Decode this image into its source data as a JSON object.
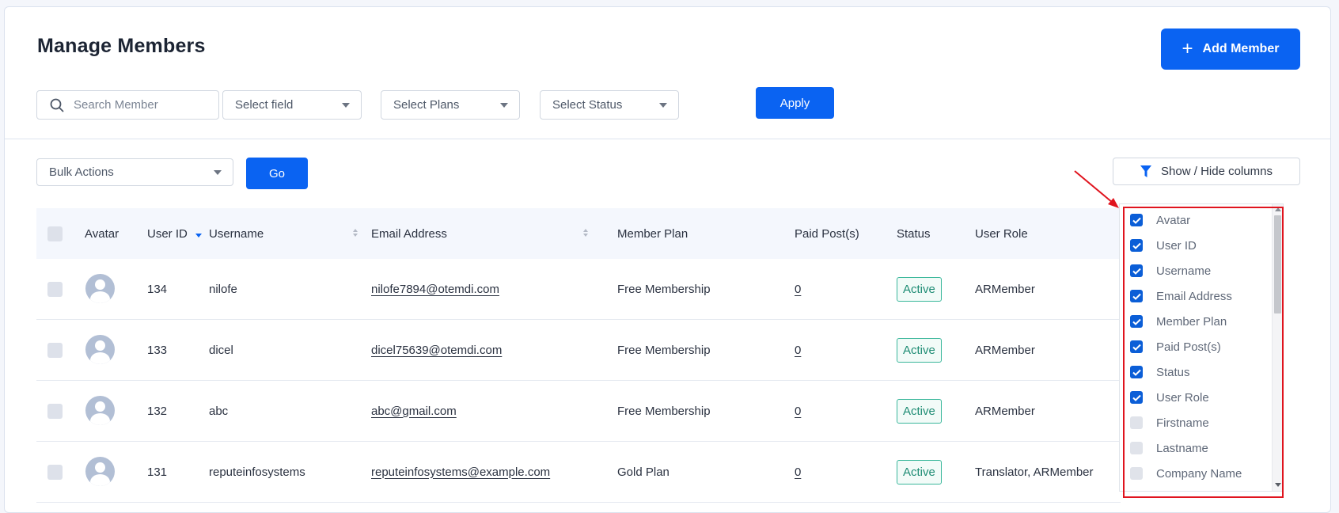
{
  "page": {
    "title": "Manage Members",
    "add_button": "Add Member"
  },
  "filters": {
    "search_placeholder": "Search Member",
    "field": "Select field",
    "plans": "Select Plans",
    "status": "Select Status",
    "apply": "Apply"
  },
  "bulk": {
    "actions": "Bulk Actions",
    "go": "Go",
    "show_hide": "Show / Hide columns"
  },
  "table": {
    "headers": {
      "avatar": "Avatar",
      "user_id": "User ID",
      "username": "Username",
      "email": "Email Address",
      "plan": "Member Plan",
      "paid_posts": "Paid Post(s)",
      "status": "Status",
      "role": "User Role"
    },
    "rows": [
      {
        "user_id": "134",
        "username": "nilofe",
        "email": "nilofe7894@otemdi.com",
        "plan": "Free Membership",
        "paid_posts": "0",
        "status": "Active",
        "role": "ARMember"
      },
      {
        "user_id": "133",
        "username": "dicel",
        "email": "dicel75639@otemdi.com",
        "plan": "Free Membership",
        "paid_posts": "0",
        "status": "Active",
        "role": "ARMember"
      },
      {
        "user_id": "132",
        "username": "abc",
        "email": "abc@gmail.com",
        "plan": "Free Membership",
        "paid_posts": "0",
        "status": "Active",
        "role": "ARMember"
      },
      {
        "user_id": "131",
        "username": "reputeinfosystems",
        "email": "reputeinfosystems@example.com",
        "plan": "Gold Plan",
        "paid_posts": "0",
        "status": "Active",
        "role": "Translator, ARMember"
      }
    ]
  },
  "columns_panel": {
    "items": [
      {
        "label": "Avatar",
        "checked": true
      },
      {
        "label": "User ID",
        "checked": true
      },
      {
        "label": "Username",
        "checked": true
      },
      {
        "label": "Email Address",
        "checked": true
      },
      {
        "label": "Member Plan",
        "checked": true
      },
      {
        "label": "Paid Post(s)",
        "checked": true
      },
      {
        "label": "Status",
        "checked": true
      },
      {
        "label": "User Role",
        "checked": true
      },
      {
        "label": "Firstname",
        "checked": false
      },
      {
        "label": "Lastname",
        "checked": false
      },
      {
        "label": "Company Name",
        "checked": false
      }
    ]
  },
  "colors": {
    "primary": "#0a63f2",
    "highlight": "#e0141e",
    "status_active": "#3ab79b"
  }
}
